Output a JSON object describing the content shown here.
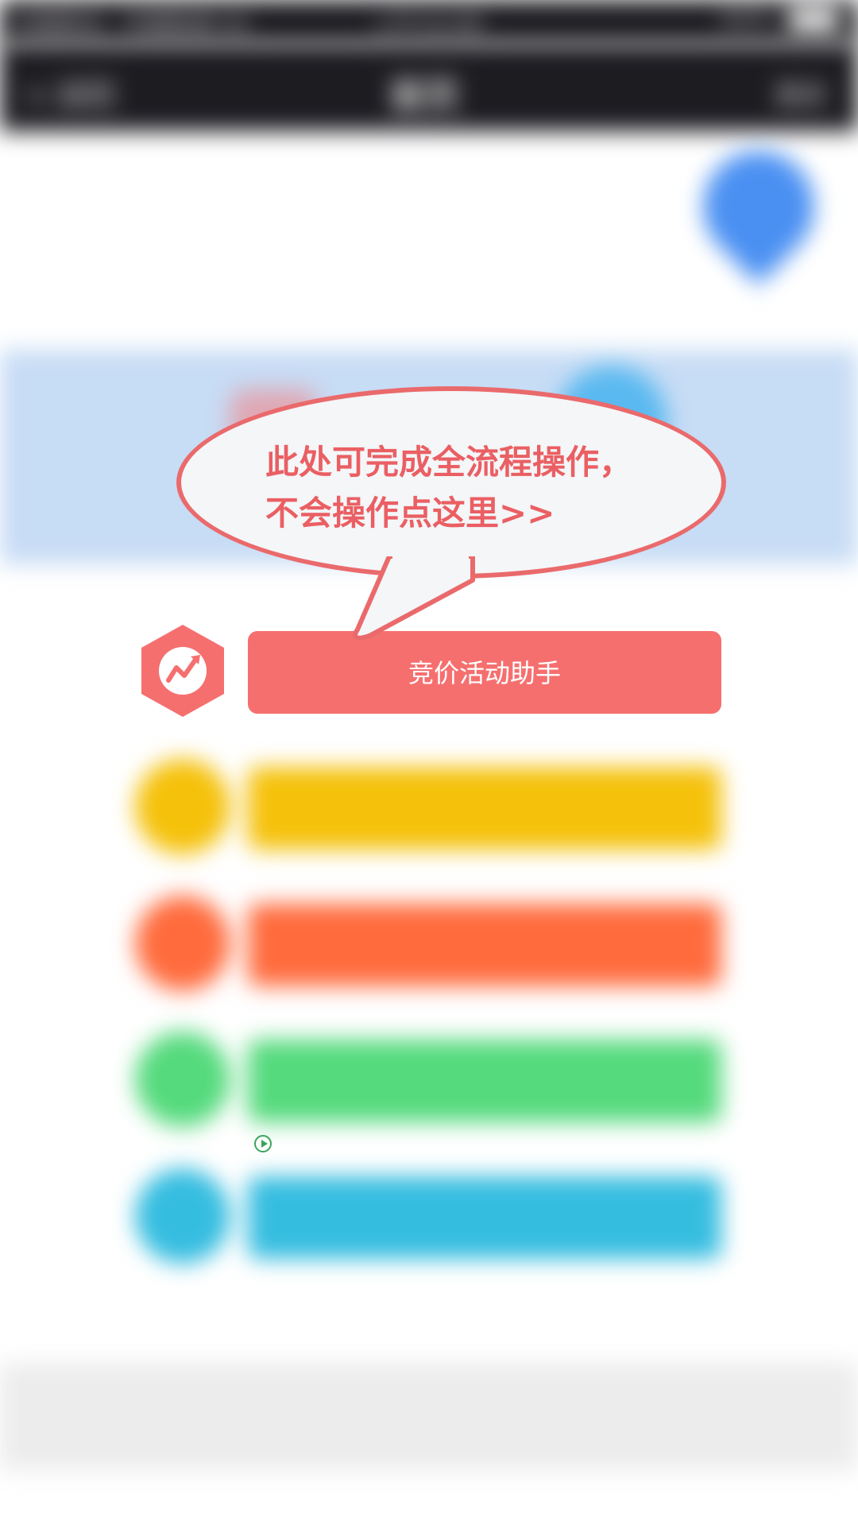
{
  "status_bar": {
    "left": "中国移动 · 中国联通 4G",
    "center": "上午10:08",
    "right": "62%"
  },
  "nav": {
    "back": "< 返回",
    "title": "首页",
    "more": "更多"
  },
  "tooltip": {
    "line1": "此处可完成全流程操作，",
    "line2": "不会操作点这里>>"
  },
  "buttons": [
    {
      "label": "竞价活动助手",
      "color": "#f66f6f",
      "icon": "trend-up-icon"
    },
    {
      "label": "",
      "color": "#f5c10a",
      "icon": "circle-icon"
    },
    {
      "label": "",
      "color": "#ff6b3d",
      "icon": "circle-icon"
    },
    {
      "label": "",
      "color": "#55da7d",
      "icon": "circle-icon"
    },
    {
      "label": "",
      "color": "#35bde0",
      "icon": "circle-icon"
    }
  ],
  "footer": {
    "line1": "",
    "link": "",
    "line2": ""
  }
}
